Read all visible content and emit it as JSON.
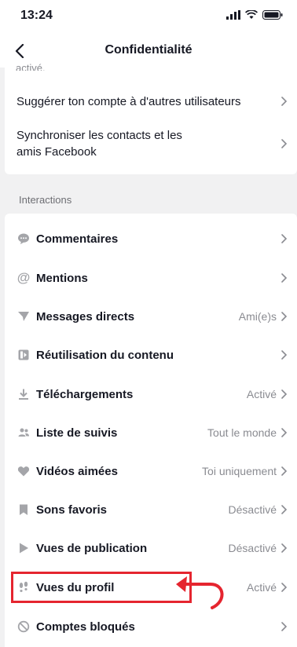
{
  "status": {
    "time": "13:24"
  },
  "header": {
    "title": "Confidentialité"
  },
  "cut_text": "activé.",
  "top_items": [
    {
      "label": "Suggérer ton compte à d'autres utilisateurs"
    },
    {
      "label_line1": "Synchroniser les contacts et les",
      "label_line2": "amis Facebook"
    }
  ],
  "section": {
    "label": "Interactions"
  },
  "items": [
    {
      "label": "Commentaires",
      "value": "",
      "icon": "comment-icon"
    },
    {
      "label": "Mentions",
      "value": "",
      "icon": "at-sign-icon"
    },
    {
      "label": "Messages directs",
      "value": "Ami(e)s",
      "icon": "send-icon"
    },
    {
      "label": "Réutilisation du contenu",
      "value": "",
      "icon": "reuse-icon"
    },
    {
      "label": "Téléchargements",
      "value": "Activé",
      "icon": "download-icon"
    },
    {
      "label": "Liste de suivis",
      "value": "Tout le monde",
      "icon": "people-icon"
    },
    {
      "label": "Vidéos aimées",
      "value": "Toi uniquement",
      "icon": "heart-icon"
    },
    {
      "label": "Sons favoris",
      "value": "Désactivé",
      "icon": "bookmark-icon"
    },
    {
      "label": "Vues de publication",
      "value": "Désactivé",
      "icon": "play-icon"
    },
    {
      "label": "Vues du profil",
      "value": "Activé",
      "icon": "footprint-icon"
    },
    {
      "label": "Comptes bloqués",
      "value": "",
      "icon": "block-icon"
    }
  ],
  "annotation": {
    "color": "#e5252f"
  }
}
